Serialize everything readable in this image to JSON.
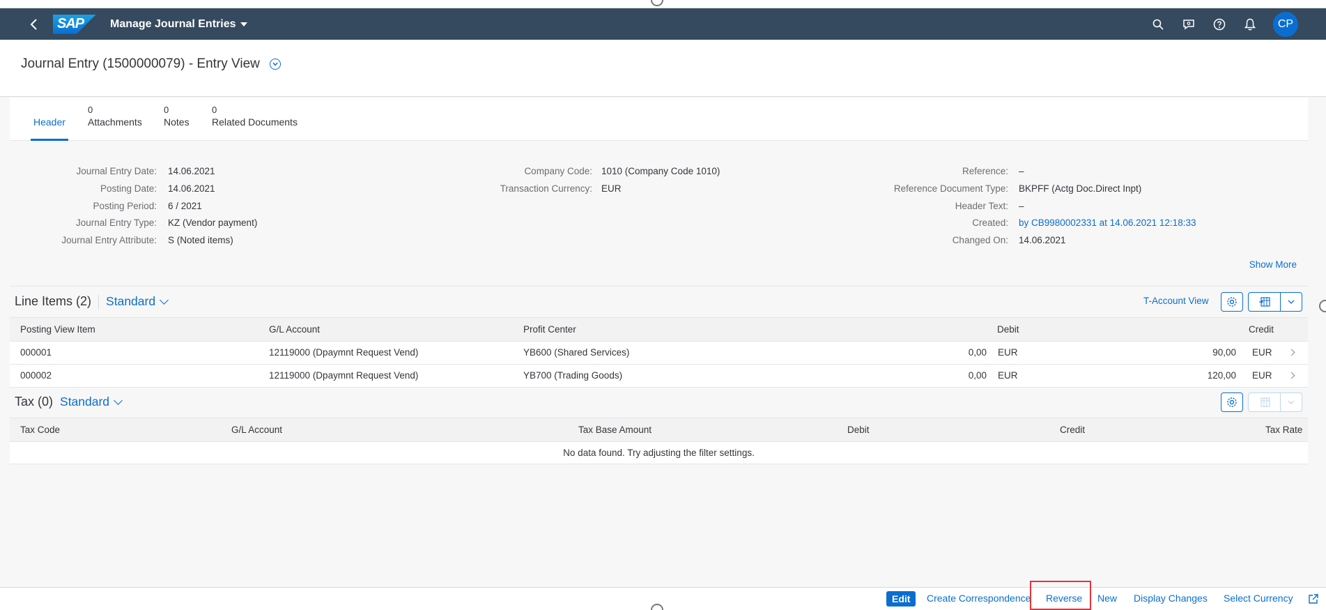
{
  "shell": {
    "logo_text": "SAP",
    "app_title": "Manage Journal Entries",
    "avatar_initials": "CP",
    "icons": [
      "back-icon",
      "search-icon",
      "feedback-icon",
      "help-icon",
      "notifications-icon"
    ]
  },
  "object_header": {
    "title": "Journal Entry (1500000079) - Entry View"
  },
  "tabs": [
    {
      "count": "",
      "label": "Header"
    },
    {
      "count": "0",
      "label": "Attachments"
    },
    {
      "count": "0",
      "label": "Notes"
    },
    {
      "count": "0",
      "label": "Related Documents"
    }
  ],
  "header_fields": {
    "col1": [
      {
        "label": "Journal Entry Date:",
        "value": "14.06.2021"
      },
      {
        "label": "Posting Date:",
        "value": "14.06.2021"
      },
      {
        "label": "Posting Period:",
        "value": "6 / 2021"
      },
      {
        "label": "Journal Entry Type:",
        "value": "KZ (Vendor payment)"
      },
      {
        "label": "Journal Entry Attribute:",
        "value": "S (Noted items)"
      }
    ],
    "col2": [
      {
        "label": "Company Code:",
        "value": "1010 (Company Code 1010)"
      },
      {
        "label": "Transaction Currency:",
        "value": "EUR"
      }
    ],
    "col3": [
      {
        "label": "Reference:",
        "value": "–"
      },
      {
        "label": "Reference Document Type:",
        "value": "BKPFF (Actg Doc.Direct Inpt)"
      },
      {
        "label": "Header Text:",
        "value": "–"
      },
      {
        "label": "Created:",
        "value": "by CB9980002331 at 14.06.2021 12:18:33"
      },
      {
        "label": "Changed On:",
        "value": "14.06.2021"
      }
    ],
    "show_more": "Show More"
  },
  "line_items": {
    "title": "Line Items (2)",
    "variant": "Standard",
    "t_account_link": "T-Account View",
    "columns": [
      "Posting View Item",
      "G/L Account",
      "Profit Center",
      "Debit",
      "Credit"
    ],
    "rows": [
      {
        "item": "000001",
        "gl": "12119000 (Dpaymnt Request Vend)",
        "pc": "YB600 (Shared Services)",
        "debit": "0,00",
        "debit_cur": "EUR",
        "credit": "90,00",
        "credit_cur": "EUR"
      },
      {
        "item": "000002",
        "gl": "12119000 (Dpaymnt Request Vend)",
        "pc": "YB700 (Trading Goods)",
        "debit": "0,00",
        "debit_cur": "EUR",
        "credit": "120,00",
        "credit_cur": "EUR"
      }
    ]
  },
  "tax": {
    "title": "Tax (0)",
    "variant": "Standard",
    "columns": [
      "Tax Code",
      "G/L Account",
      "Tax Base Amount",
      "Debit",
      "Credit",
      "Tax Rate"
    ],
    "no_data": "No data found. Try adjusting the filter settings."
  },
  "footer": {
    "edit": "Edit",
    "create_correspondence": "Create Correspondence",
    "reverse": "Reverse",
    "new": "New",
    "display_changes": "Display Changes",
    "select_currency": "Select Currency"
  },
  "colors": {
    "shell_bg": "#354a5f",
    "accent": "#0a6ed1",
    "highlight": "#e0343a"
  }
}
